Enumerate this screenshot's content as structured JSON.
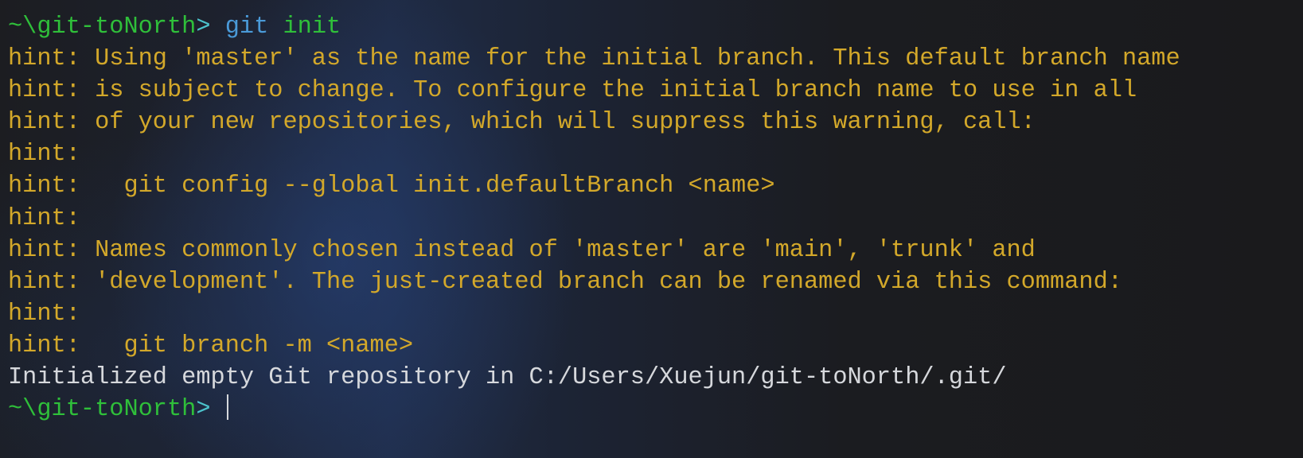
{
  "terminal": {
    "prompt_path": "~\\git-toNorth",
    "prompt_symbol": ">",
    "command_name": "git",
    "command_args": "init",
    "hint_lines": [
      "hint: Using 'master' as the name for the initial branch. This default branch name",
      "hint: is subject to change. To configure the initial branch name to use in all",
      "hint: of your new repositories, which will suppress this warning, call:",
      "hint:",
      "hint:   git config --global init.defaultBranch <name>",
      "hint:",
      "hint: Names commonly chosen instead of 'master' are 'main', 'trunk' and",
      "hint: 'development'. The just-created branch can be renamed via this command:",
      "hint:",
      "hint:   git branch -m <name>"
    ],
    "result_line": "Initialized empty Git repository in C:/Users/Xuejun/git-toNorth/.git/",
    "colors": {
      "path": "#2fbf3a",
      "symbol": "#4cc3cc",
      "command": "#4a9ad8",
      "hint": "#d3a82a",
      "output": "#d6d8dc"
    }
  }
}
